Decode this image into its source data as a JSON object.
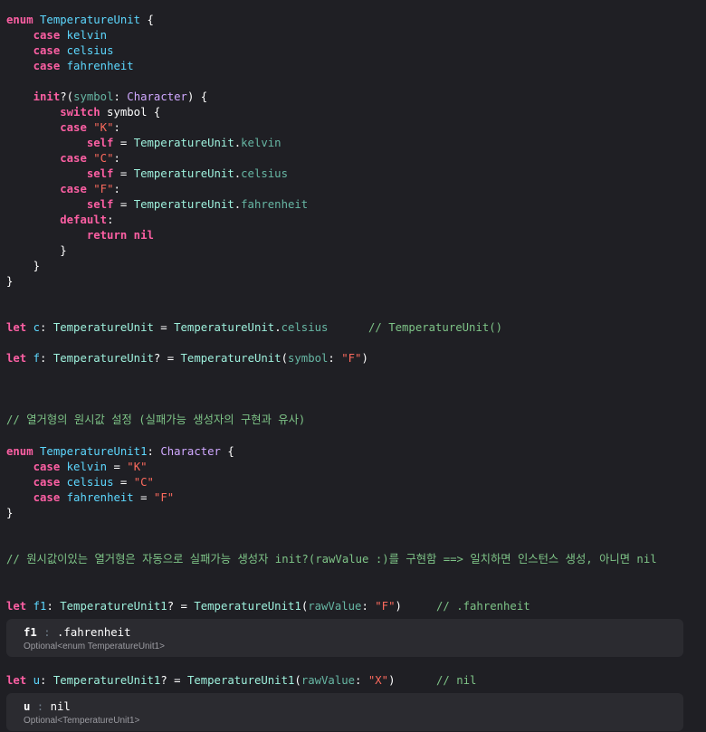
{
  "code": {
    "enum1": {
      "l1_kw": "enum",
      "l1_name": "TemperatureUnit",
      "l1_brace": " {",
      "case_kw": "case",
      "case_kelvin": "kelvin",
      "case_celsius": "celsius",
      "case_fahrenheit": "fahrenheit",
      "init_kw": "init",
      "init_q": "?(",
      "param_name": "symbol",
      "colon": ": ",
      "param_type": "Character",
      "init_close": ") {",
      "switch_kw": "switch",
      "switch_subject": " symbol {",
      "str_K": "\"K\"",
      "str_C": "\"C\"",
      "str_F": "\"F\"",
      "case_colon": ":",
      "self_kw": "self",
      "assign": " = ",
      "type_name": "TemperatureUnit",
      "dot": ".",
      "default_kw": "default",
      "default_colon": ":",
      "return_kw": "return",
      "nil_kw": "nil",
      "close_brace": "}"
    },
    "let_c": {
      "kw": "let",
      "name": "c",
      "colon": ": ",
      "type": "TemperatureUnit",
      "assign": " = ",
      "value_type": "TemperatureUnit",
      "dot": ".",
      "member": "celsius",
      "comment": "// TemperatureUnit()"
    },
    "let_f": {
      "kw": "let",
      "name": "f",
      "colon": ": ",
      "type": "TemperatureUnit",
      "optional": "?",
      "assign": " = ",
      "call": "TemperatureUnit",
      "open": "(",
      "label": "symbol",
      "label_colon": ": ",
      "arg": "\"F\"",
      "close": ")"
    },
    "comment_rawvalue": "// 열거형의 원시값 설정 (실패가능 생성자의 구현과 유사)",
    "enum2": {
      "kw": "enum",
      "name": "TemperatureUnit1",
      "colon": ": ",
      "raw_type": "Character",
      "brace": " {",
      "case_kw": "case",
      "kelvin": "kelvin",
      "kelvin_val": "\"K\"",
      "celsius": "celsius",
      "celsius_val": "\"C\"",
      "fahrenheit": "fahrenheit",
      "fahrenheit_val": "\"F\"",
      "eq": " = ",
      "close": "}"
    },
    "comment_auto": "// 원시값이있는 열거형은 자동으로 실패가능 생성자 init?(rawValue :)를 구현함 ==> 일치하면 인스턴스 생성, 아니면 nil",
    "let_f1": {
      "kw": "let",
      "name": "f1",
      "colon": ": ",
      "type": "TemperatureUnit1",
      "optional": "?",
      "assign": " = ",
      "call": "TemperatureUnit1",
      "open": "(",
      "label": "rawValue",
      "label_colon": ": ",
      "arg": "\"F\"",
      "close": ")",
      "comment": "// .fahrenheit"
    },
    "let_u": {
      "kw": "let",
      "name": "u",
      "colon": ": ",
      "type": "TemperatureUnit1",
      "optional": "?",
      "assign": " = ",
      "call": "TemperatureUnit1",
      "open": "(",
      "label": "rawValue",
      "label_colon": ": ",
      "arg": "\"X\"",
      "close": ")",
      "comment": "// nil"
    }
  },
  "results": {
    "f1": {
      "name": "f1",
      "sep": " : ",
      "value": ".fahrenheit",
      "type": "Optional<enum TemperatureUnit1>"
    },
    "u": {
      "name": "u",
      "sep": " : ",
      "value": "nil",
      "type": "Optional<TemperatureUnit1>"
    }
  },
  "colors": {
    "background": "#1f1f24",
    "keyword": "#fc5fa3",
    "type": "#5dd8ff",
    "string": "#fc6a5d",
    "comment": "#7ec487",
    "result_bg": "#2b2b30"
  }
}
